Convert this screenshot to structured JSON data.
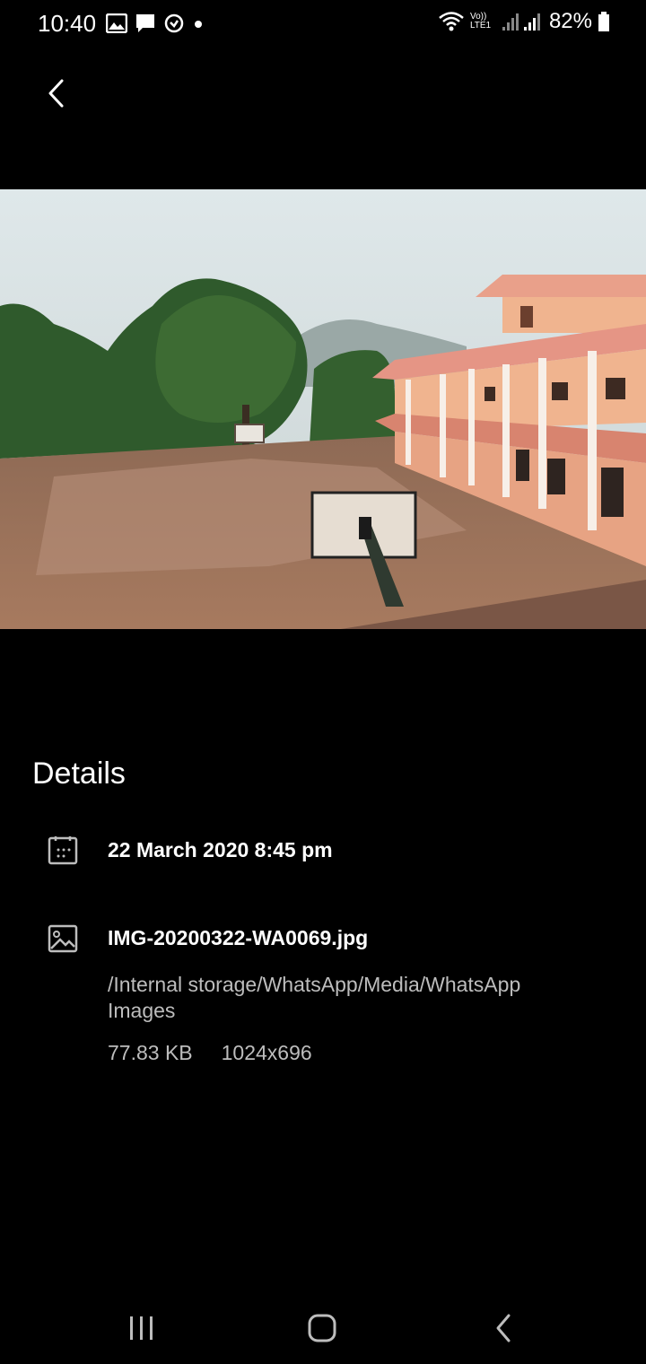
{
  "status_bar": {
    "time": "10:40",
    "battery": "82%",
    "network_label": "Vo)) LTE1",
    "icons": [
      "gallery-icon",
      "message-icon",
      "sync-icon",
      "dot-icon",
      "wifi-icon",
      "signal-icon",
      "battery-icon"
    ]
  },
  "header": {
    "back_icon": "chevron-left-icon"
  },
  "photo": {
    "description_hidden": true
  },
  "details": {
    "title": "Details",
    "date": "22 March 2020 8:45 pm",
    "filename": "IMG-20200322-WA0069.jpg",
    "path": "/Internal storage/WhatsApp/Media/WhatsApp Images",
    "size": "77.83 KB",
    "resolution": "1024x696"
  },
  "nav_bar": {
    "icons": [
      "recent-apps-icon",
      "home-icon",
      "back-icon"
    ]
  }
}
